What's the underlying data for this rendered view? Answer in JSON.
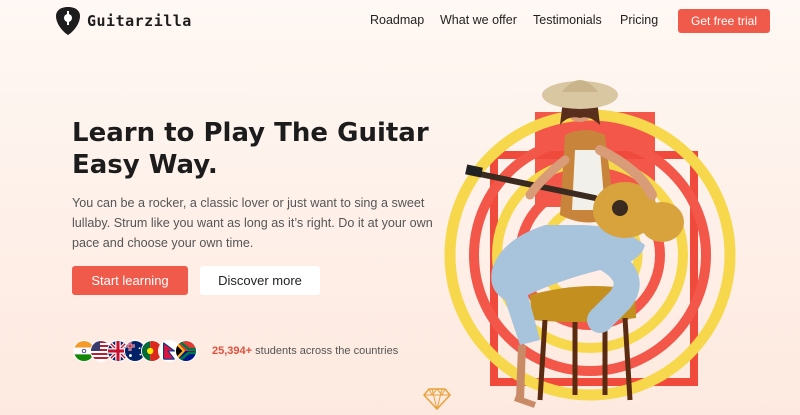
{
  "brand": {
    "name": "Guitarzilla"
  },
  "nav": {
    "items": [
      "Roadmap",
      "What we offer",
      "Testimonials",
      "Pricing"
    ],
    "cta": "Get free trial"
  },
  "hero": {
    "title_line1": "Learn to Play The Guitar",
    "title_line2": "Easy Way.",
    "subtitle": "You can be a rocker, a classic lover or just want to sing a sweet lullaby. Strum like you want as long as it’s right. Do it at your own pace and choose your own time.",
    "primary_button": "Start learning",
    "secondary_button": "Discover more"
  },
  "students": {
    "count": "25,394+",
    "text": " students across the countries",
    "flags": [
      "india-flag-icon",
      "usa-flag-icon",
      "uk-flag-icon",
      "australia-flag-icon",
      "portugal-flag-icon",
      "nepal-flag-icon",
      "south-africa-flag-icon"
    ]
  },
  "colors": {
    "accent": "#f05a4b",
    "yellow": "#f6d64b",
    "dark": "#1c1c1c"
  }
}
